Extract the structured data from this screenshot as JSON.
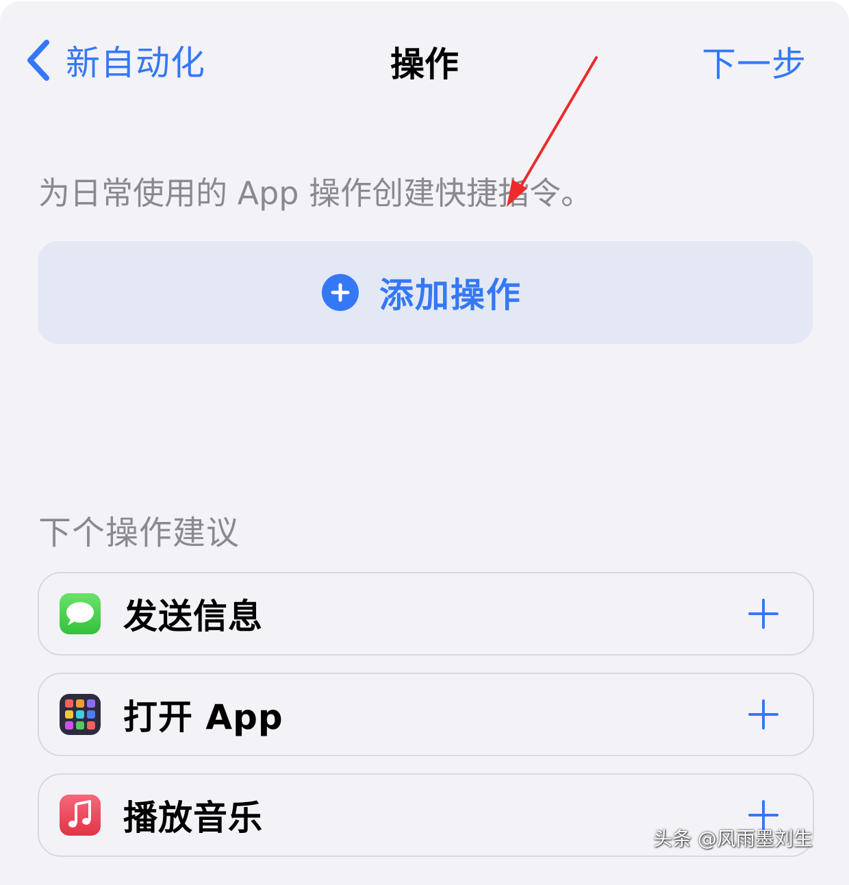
{
  "colors": {
    "accent": "#3478f6",
    "background": "#f2f2f7",
    "add_action_bg": "#e3e8f4",
    "secondary_text": "#8a8a8e",
    "annotation_arrow": "#ee2a2a"
  },
  "nav": {
    "back_icon": "chevron-left-icon",
    "back_label": "新自动化",
    "title": "操作",
    "next_label": "下一步"
  },
  "description": "为日常使用的 App 操作创建快捷指令。",
  "add_action": {
    "icon": "plus-circle-icon",
    "label": "添加操作"
  },
  "suggestions": {
    "header": "下个操作建议",
    "items": [
      {
        "label": "发送信息",
        "icon": "messages-app-icon",
        "action_icon": "plus-icon"
      },
      {
        "label": "打开 App",
        "icon": "app-grid-icon",
        "action_icon": "plus-icon"
      },
      {
        "label": "播放音乐",
        "icon": "music-app-icon",
        "action_icon": "plus-icon"
      }
    ]
  },
  "watermark": "头条 @风雨墨刘生"
}
